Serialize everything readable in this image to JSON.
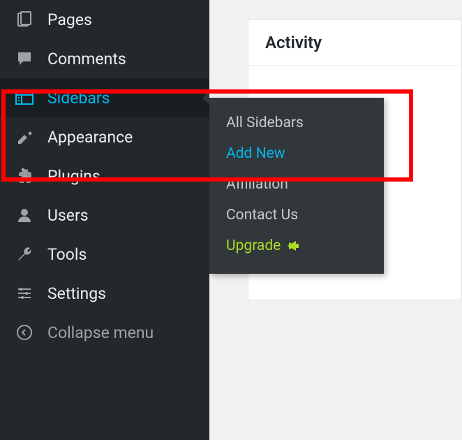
{
  "sidebar": {
    "items": [
      {
        "label": "Pages",
        "icon": "pages-icon",
        "active": false
      },
      {
        "label": "Comments",
        "icon": "comments-icon",
        "active": false
      },
      {
        "label": "Sidebars",
        "icon": "sidebars-icon",
        "active": true
      },
      {
        "label": "Appearance",
        "icon": "appearance-icon",
        "active": false
      },
      {
        "label": "Plugins",
        "icon": "plugins-icon",
        "active": false
      },
      {
        "label": "Users",
        "icon": "users-icon",
        "active": false
      },
      {
        "label": "Tools",
        "icon": "tools-icon",
        "active": false
      },
      {
        "label": "Settings",
        "icon": "settings-icon",
        "active": false
      }
    ],
    "collapse_label": "Collapse menu"
  },
  "submenu": {
    "items": [
      {
        "label": "All Sidebars",
        "style": "normal"
      },
      {
        "label": "Add New",
        "style": "highlight"
      },
      {
        "label": "Affiliation",
        "style": "normal"
      },
      {
        "label": "Contact Us",
        "style": "normal"
      },
      {
        "label": "Upgrade",
        "style": "upgrade"
      }
    ]
  },
  "panel": {
    "title": "Activity"
  },
  "colors": {
    "accent": "#00b9eb",
    "upgrade": "#aadd22",
    "sidebar_bg": "#23282d",
    "submenu_bg": "#32373c"
  }
}
